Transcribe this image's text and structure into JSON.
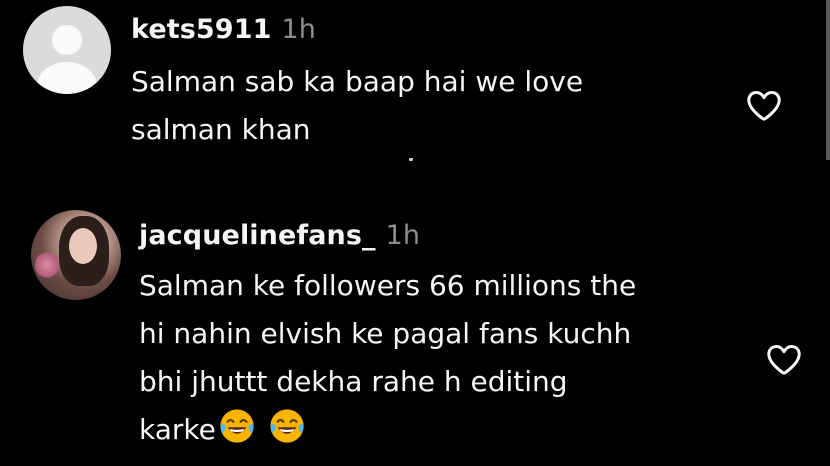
{
  "comments": [
    {
      "username": "kets5911",
      "time": "1h",
      "avatar": "default-avatar-icon",
      "lines": [
        "Salman sab ka baap hai we love",
        "salman khan"
      ]
    },
    {
      "username": "jacquelinefans_",
      "time": "1h",
      "avatar": "profile-photo",
      "lines": [
        "Salman ke followers 66 millions the",
        "hi nahin elvish ke pagal fans kuchh",
        "bhi jhuttt dekha rahe h editing",
        "karke"
      ],
      "trailing_emoji": [
        "😂",
        "😂"
      ]
    }
  ],
  "icons": {
    "like": "heart-outline-icon",
    "emoji": "tears-of-joy-emoji"
  },
  "colors": {
    "background": "#000000",
    "text": "#f5f5f5",
    "meta": "#8e8e8e",
    "emoji_face": "#f7b500"
  }
}
